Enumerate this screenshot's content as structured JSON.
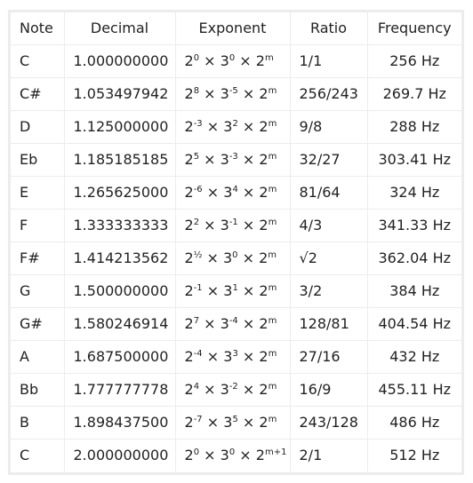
{
  "table": {
    "headers": {
      "note": "Note",
      "decimal": "Decimal",
      "exponent": "Exponent",
      "ratio": "Ratio",
      "frequency": "Frequency"
    },
    "rows": [
      {
        "note": "C",
        "decimal": "1.000000000",
        "e2": "0",
        "e3": "0",
        "em": "m",
        "ratio": "1/1",
        "frequency": "256 Hz"
      },
      {
        "note": "C#",
        "decimal": "1.053497942",
        "e2": "8",
        "e3": "-5",
        "em": "m",
        "ratio": "256/243",
        "frequency": "269.7 Hz"
      },
      {
        "note": "D",
        "decimal": "1.125000000",
        "e2": "-3",
        "e3": "2",
        "em": "m",
        "ratio": "9/8",
        "frequency": "288 Hz"
      },
      {
        "note": "Eb",
        "decimal": "1.185185185",
        "e2": "5",
        "e3": "-3",
        "em": "m",
        "ratio": "32/27",
        "frequency": "303.41 Hz"
      },
      {
        "note": "E",
        "decimal": "1.265625000",
        "e2": "-6",
        "e3": "4",
        "em": "m",
        "ratio": "81/64",
        "frequency": "324 Hz"
      },
      {
        "note": "F",
        "decimal": "1.333333333",
        "e2": "2",
        "e3": "-1",
        "em": "m",
        "ratio": "4/3",
        "frequency": "341.33 Hz"
      },
      {
        "note": "F#",
        "decimal": "1.414213562",
        "e2": "½",
        "e3": "0",
        "em": "m",
        "ratio": "√2",
        "frequency": "362.04 Hz"
      },
      {
        "note": "G",
        "decimal": "1.500000000",
        "e2": "-1",
        "e3": "1",
        "em": "m",
        "ratio": "3/2",
        "frequency": "384 Hz"
      },
      {
        "note": "G#",
        "decimal": "1.580246914",
        "e2": "7",
        "e3": "-4",
        "em": "m",
        "ratio": "128/81",
        "frequency": "404.54 Hz"
      },
      {
        "note": "A",
        "decimal": "1.687500000",
        "e2": "-4",
        "e3": "3",
        "em": "m",
        "ratio": "27/16",
        "frequency": "432 Hz"
      },
      {
        "note": "Bb",
        "decimal": "1.777777778",
        "e2": "4",
        "e3": "-2",
        "em": "m",
        "ratio": "16/9",
        "frequency": "455.11 Hz"
      },
      {
        "note": "B",
        "decimal": "1.898437500",
        "e2": "-7",
        "e3": "5",
        "em": "m",
        "ratio": "243/128",
        "frequency": "486 Hz"
      },
      {
        "note": "C",
        "decimal": "2.000000000",
        "e2": "0",
        "e3": "0",
        "em": "m+1",
        "ratio": "2/1",
        "frequency": "512 Hz"
      }
    ],
    "exponent_format": {
      "base_two": "2",
      "base_three": "3",
      "times": " × "
    }
  }
}
